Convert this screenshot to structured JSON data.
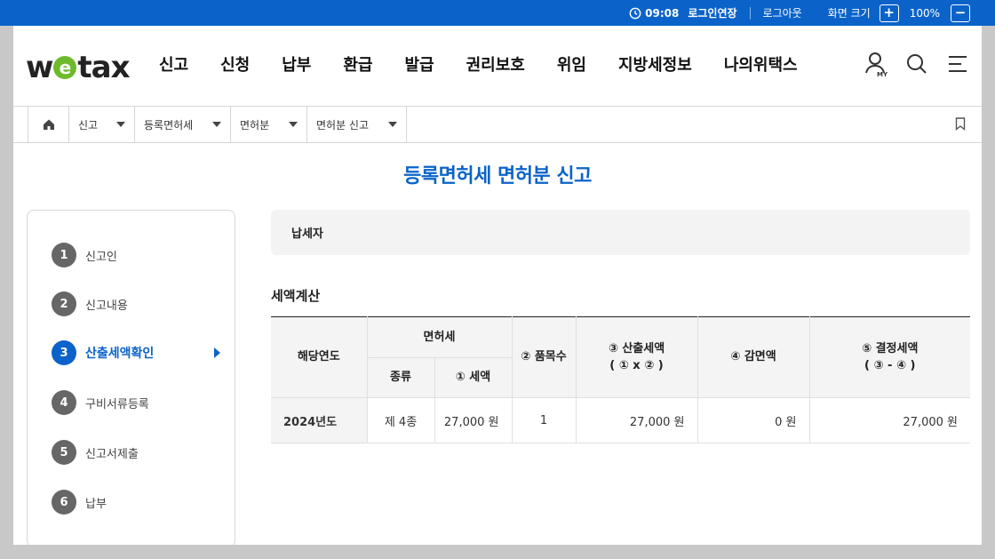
{
  "topbar": {
    "time": "09:08",
    "extend_login": "로그인연장",
    "logout": "로그아웃",
    "screen_size_label": "화면 크기",
    "zoom_in": "+",
    "zoom_level": "100%",
    "zoom_out": "−"
  },
  "header": {
    "logo_parts": {
      "pre": "w",
      "e": "e",
      "post": "tax"
    },
    "nav": [
      "신고",
      "신청",
      "납부",
      "환급",
      "발급",
      "권리보호",
      "위임",
      "지방세정보",
      "나의위택스"
    ],
    "my_label": "MY"
  },
  "breadcrumb": {
    "items": [
      "신고",
      "등록면허세",
      "면허분",
      "면허분 신고"
    ]
  },
  "page_title": "등록면허세 면허분 신고",
  "steps": [
    {
      "num": "1",
      "label": "신고인",
      "active": false
    },
    {
      "num": "2",
      "label": "신고내용",
      "active": false
    },
    {
      "num": "3",
      "label": "산출세액확인",
      "active": true
    },
    {
      "num": "4",
      "label": "구비서류등록",
      "active": false
    },
    {
      "num": "5",
      "label": "신고서제출",
      "active": false
    },
    {
      "num": "6",
      "label": "납부",
      "active": false
    }
  ],
  "taxpayer_label": "납세자",
  "calc": {
    "title": "세액계산",
    "headers": {
      "year": "해당연도",
      "license_tax": "면허세",
      "kind": "종류",
      "tax": "① 세액",
      "items": "② 품목수",
      "calc_tax_l1": "③ 산출세액",
      "calc_tax_l2": "( ① x ② )",
      "reduction": "④ 감면액",
      "final_l1": "⑤ 결정세액",
      "final_l2": "( ③ - ④ )"
    },
    "row": {
      "year": "2024년도",
      "kind": "제 4종",
      "tax": "27,000 원",
      "items": "1",
      "calc_tax": "27,000 원",
      "reduction": "0 원",
      "final": "27,000 원"
    }
  },
  "colors": {
    "primary": "#0b63c9",
    "logo_green": "#6fba2c"
  }
}
